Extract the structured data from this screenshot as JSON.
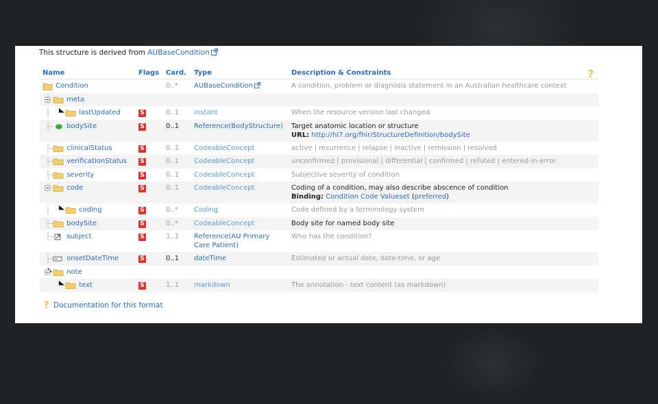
{
  "header": {
    "prefix": "This structure is derived from ",
    "base_link": "AUBaseCondition"
  },
  "columns": {
    "name": "Name",
    "flags": "Flags",
    "card": "Card.",
    "type": "Type",
    "desc": "Description & Constraints"
  },
  "rows": [
    {
      "name": "Condition",
      "card": "0..*",
      "type": "AUBaseCondition",
      "desc": "A condition, problem or diagnosis statement in an Australian healthcare context"
    },
    {
      "name": "meta"
    },
    {
      "name": "lastUpdated",
      "flag": "S",
      "card": "0..1",
      "type": "instant",
      "desc": "When the resource version last changed"
    },
    {
      "name": "bodySite",
      "flag": "S",
      "card": "0..1",
      "type_prefix": "Reference(",
      "type_link": "BodyStructure",
      "type_suffix": ")",
      "desc": "Target anatomic location or structure",
      "url_label": "URL:",
      "url": "http://hl7.org/fhir/StructureDefinition/bodySite"
    },
    {
      "name": "clinicalStatus",
      "flag": "S",
      "card": "0..1",
      "type": "CodeableConcept",
      "desc": "active | recurrence | relapse | inactive | remission | resolved"
    },
    {
      "name": "verificationStatus",
      "flag": "S",
      "card": "0..1",
      "type": "CodeableConcept",
      "desc": "unconfirmed | provisional | differential | confirmed | refuted | entered-in-error"
    },
    {
      "name": "severity",
      "flag": "S",
      "card": "0..1",
      "type": "CodeableConcept",
      "desc": "Subjective severity of condition"
    },
    {
      "name": "code",
      "flag": "S",
      "card": "0..1",
      "type": "CodeableConcept",
      "desc": "Coding of a condition, may also describe abscence of condition",
      "binding_label": "Binding:",
      "binding_link": "Condition Code Valueset",
      "binding_open": " (",
      "binding_strength": "preferred",
      "binding_close": ")"
    },
    {
      "name": "coding",
      "flag": "S",
      "card": "0..*",
      "type": "Coding",
      "desc": "Code defined by a terminology system"
    },
    {
      "name": "bodySite",
      "flag": "S",
      "card": "0..*",
      "type": "CodeableConcept",
      "desc": "Body site for named body site"
    },
    {
      "name": "subject",
      "flag": "S",
      "card": "1..1",
      "type_prefix": "Reference(",
      "type_link": "AU Primary Care Patient",
      "type_suffix": ")",
      "desc": "Who has the condition?"
    },
    {
      "name": "onsetDateTime",
      "flag": "S",
      "card": "0..1",
      "type": "dateTime",
      "desc": "Estimated or actual date, date-time, or age"
    },
    {
      "name": "note"
    },
    {
      "name": "text",
      "flag": "S",
      "card": "1..1",
      "type": "markdown",
      "desc": "The annotation - text content (as markdown)"
    }
  ],
  "footer": {
    "docs_link": "Documentation for this format"
  },
  "colors": {
    "link": "#2a6ebb",
    "flag": "#e0322f",
    "stripe": "#f3f3f3",
    "folder": "#f5cf6b"
  }
}
